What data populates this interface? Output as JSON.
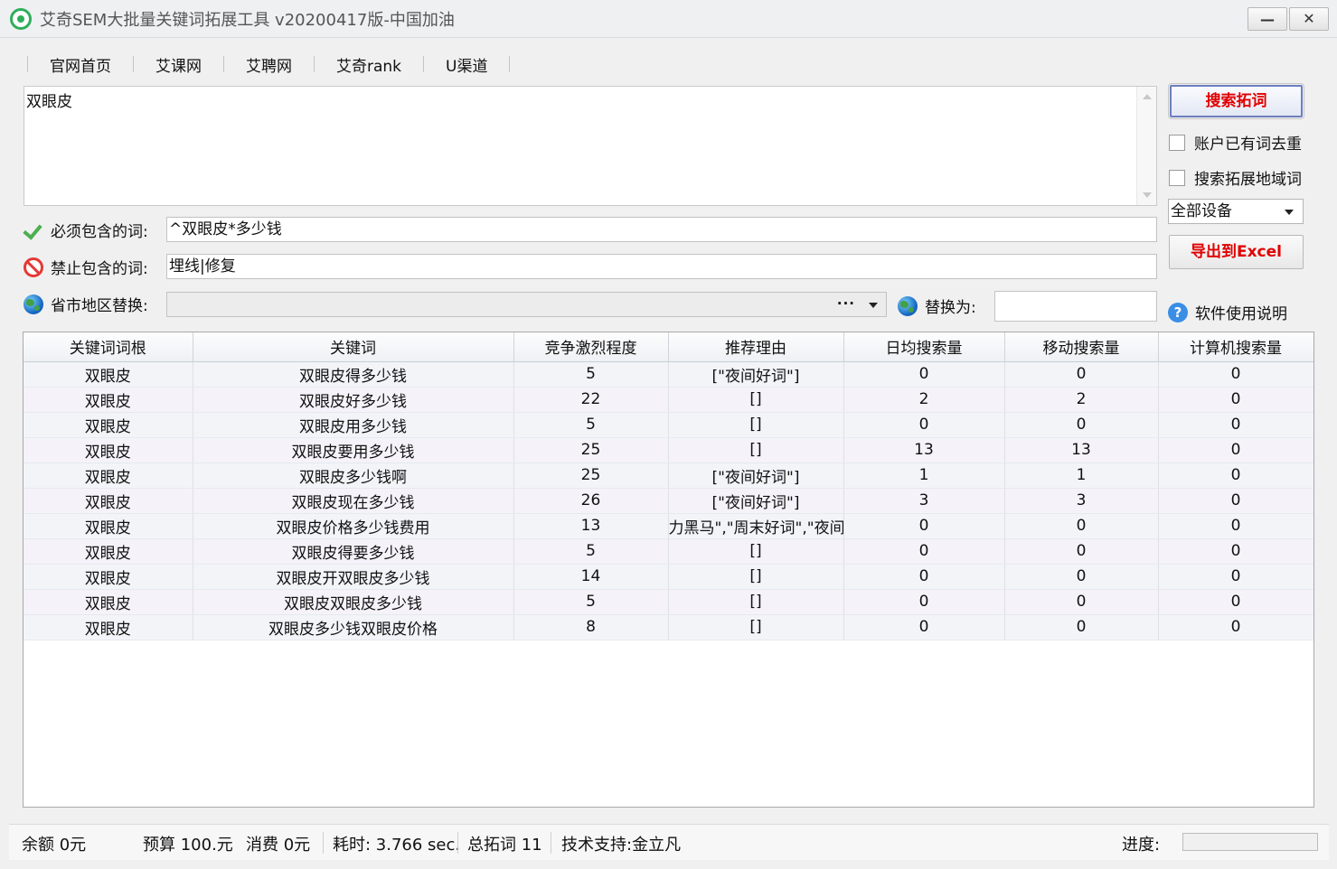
{
  "window": {
    "title": "艾奇SEM大批量关键词拓展工具 v20200417版-中国加油",
    "minimize": "—",
    "close": "✕"
  },
  "nav": [
    "官网首页",
    "艾课网",
    "艾聘网",
    "艾奇rank",
    "U渠道"
  ],
  "keywords_text": "双眼皮",
  "filters": {
    "must_label": "必须包含的词:",
    "must_value": "^双眼皮*多少钱",
    "ban_label": "禁止包含的词:",
    "ban_value": "埋线|修复",
    "region_label": "省市地区替换:",
    "region_dots": "···",
    "replace_label": "替换为:",
    "replace_value": ""
  },
  "side": {
    "search_button": "搜索拓词",
    "dedupe_label": "账户已有词去重",
    "dedupe_checked": false,
    "region_expand_label": "搜索拓展地域词",
    "region_expand_checked": false,
    "device": "全部设备",
    "export_button": "导出到Excel",
    "help_icon": "?",
    "help_label": "软件使用说明"
  },
  "table": {
    "columns": [
      "关键词词根",
      "关键词",
      "竞争激烈程度",
      "推荐理由",
      "日均搜索量",
      "移动搜索量",
      "计算机搜索量"
    ],
    "rows": [
      [
        "双眼皮",
        "双眼皮得多少钱",
        "5",
        "[\"夜间好词\"]",
        "0",
        "0",
        "0"
      ],
      [
        "双眼皮",
        "双眼皮好多少钱",
        "22",
        "[]",
        "2",
        "2",
        "0"
      ],
      [
        "双眼皮",
        "双眼皮用多少钱",
        "5",
        "[]",
        "0",
        "0",
        "0"
      ],
      [
        "双眼皮",
        "双眼皮要用多少钱",
        "25",
        "[]",
        "13",
        "13",
        "0"
      ],
      [
        "双眼皮",
        "双眼皮多少钱啊",
        "25",
        "[\"夜间好词\"]",
        "1",
        "1",
        "0"
      ],
      [
        "双眼皮",
        "双眼皮现在多少钱",
        "26",
        "[\"夜间好词\"]",
        "3",
        "3",
        "0"
      ],
      [
        "双眼皮",
        "双眼皮价格多少钱费用",
        "13",
        "力黑马\",\"周末好词\",\"夜间好",
        "0",
        "0",
        "0"
      ],
      [
        "双眼皮",
        "双眼皮得要多少钱",
        "5",
        "[]",
        "0",
        "0",
        "0"
      ],
      [
        "双眼皮",
        "双眼皮开双眼皮多少钱",
        "14",
        "[]",
        "0",
        "0",
        "0"
      ],
      [
        "双眼皮",
        "双眼皮双眼皮多少钱",
        "5",
        "[]",
        "0",
        "0",
        "0"
      ],
      [
        "双眼皮",
        "双眼皮多少钱双眼皮价格",
        "8",
        "[]",
        "0",
        "0",
        "0"
      ]
    ]
  },
  "status": {
    "balance": "余额  0元",
    "budget": "预算  100.元",
    "spend": "消费   0元",
    "elapsed": "耗时: 3.766 sec.",
    "total": "总拓词 11",
    "support": "技术支持:金立凡",
    "progress_label": "进度:",
    "progress_value": 0
  }
}
